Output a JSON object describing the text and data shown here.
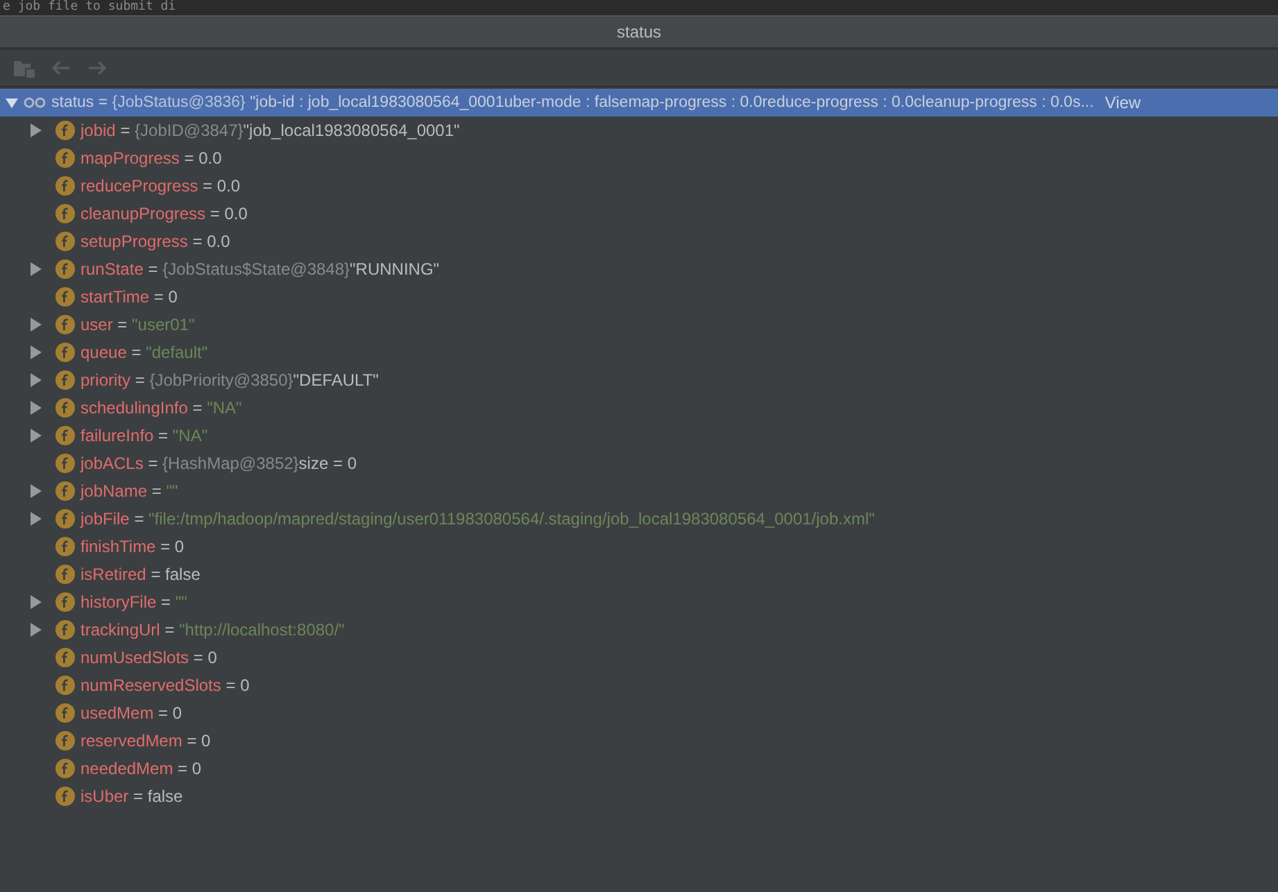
{
  "editor_fragment": "e job file to submit di",
  "panel": {
    "title": "status"
  },
  "toolbar": [
    {
      "kind": "restore",
      "disabled": true
    },
    {
      "kind": "back",
      "disabled": true
    },
    {
      "kind": "forward",
      "disabled": true
    }
  ],
  "root": {
    "name": "status",
    "eq": "=",
    "ref": "{JobStatus@3836}",
    "value": "\"job-id : job_local1983080564_0001uber-mode : falsemap-progress : 0.0reduce-progress : 0.0cleanup-progress : 0.0s...",
    "link": "View",
    "expanded": true,
    "selected": true,
    "children": [
      {
        "name": "jobid",
        "expandable": true,
        "ref": "{JobID@3847}",
        "value": "\"job_local1983080564_0001\"",
        "kind": "plain"
      },
      {
        "name": "mapProgress",
        "expandable": false,
        "value": "0.0",
        "kind": "plain"
      },
      {
        "name": "reduceProgress",
        "expandable": false,
        "value": "0.0",
        "kind": "plain"
      },
      {
        "name": "cleanupProgress",
        "expandable": false,
        "value": "0.0",
        "kind": "plain"
      },
      {
        "name": "setupProgress",
        "expandable": false,
        "value": "0.0",
        "kind": "plain"
      },
      {
        "name": "runState",
        "expandable": true,
        "ref": "{JobStatus$State@3848}",
        "value": "\"RUNNING\"",
        "kind": "plain"
      },
      {
        "name": "startTime",
        "expandable": false,
        "value": "0",
        "kind": "plain"
      },
      {
        "name": "user",
        "expandable": true,
        "value": "\"user01\"",
        "kind": "string"
      },
      {
        "name": "queue",
        "expandable": true,
        "value": "\"default\"",
        "kind": "string"
      },
      {
        "name": "priority",
        "expandable": true,
        "ref": "{JobPriority@3850}",
        "value": "\"DEFAULT\"",
        "kind": "plain"
      },
      {
        "name": "schedulingInfo",
        "expandable": true,
        "value": "\"NA\"",
        "kind": "string"
      },
      {
        "name": "failureInfo",
        "expandable": true,
        "value": "\"NA\"",
        "kind": "string"
      },
      {
        "name": "jobACLs",
        "expandable": false,
        "ref": "{HashMap@3852}",
        "value": "size = 0",
        "kind": "plain"
      },
      {
        "name": "jobName",
        "expandable": true,
        "value": "\"\"",
        "kind": "string"
      },
      {
        "name": "jobFile",
        "expandable": true,
        "value": "\"file:/tmp/hadoop/mapred/staging/user011983080564/.staging/job_local1983080564_0001/job.xml\"",
        "kind": "string"
      },
      {
        "name": "finishTime",
        "expandable": false,
        "value": "0",
        "kind": "plain"
      },
      {
        "name": "isRetired",
        "expandable": false,
        "value": "false",
        "kind": "plain"
      },
      {
        "name": "historyFile",
        "expandable": true,
        "value": "\"\"",
        "kind": "string"
      },
      {
        "name": "trackingUrl",
        "expandable": true,
        "value": "\"http://localhost:8080/\"",
        "kind": "string"
      },
      {
        "name": "numUsedSlots",
        "expandable": false,
        "value": "0",
        "kind": "plain"
      },
      {
        "name": "numReservedSlots",
        "expandable": false,
        "value": "0",
        "kind": "plain"
      },
      {
        "name": "usedMem",
        "expandable": false,
        "value": "0",
        "kind": "plain"
      },
      {
        "name": "reservedMem",
        "expandable": false,
        "value": "0",
        "kind": "plain"
      },
      {
        "name": "neededMem",
        "expandable": false,
        "value": "0",
        "kind": "plain"
      },
      {
        "name": "isUber",
        "expandable": false,
        "value": "false",
        "kind": "plain"
      }
    ]
  }
}
